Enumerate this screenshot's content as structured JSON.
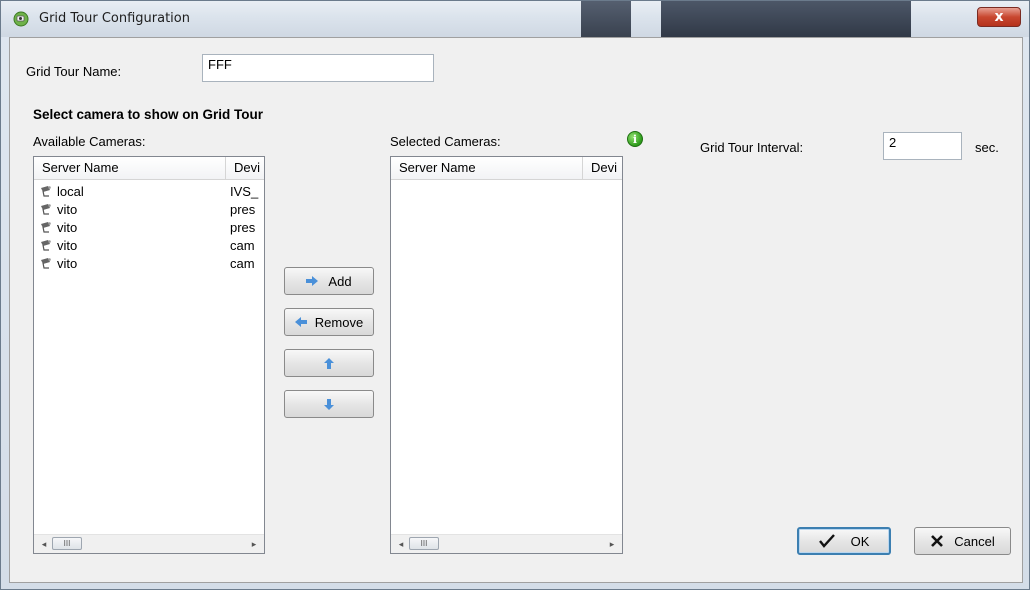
{
  "window": {
    "title": "Grid Tour Configuration",
    "close_glyph": "x"
  },
  "form": {
    "name_label": "Grid Tour Name:",
    "name_value": "FFF",
    "section_title": "Select camera to show on Grid Tour",
    "available_label": "Available Cameras:",
    "selected_label": "Selected Cameras:",
    "interval_label": "Grid Tour Interval:",
    "interval_value": "2",
    "interval_unit": "sec."
  },
  "available": {
    "columns": [
      "Server Name",
      "Devi"
    ],
    "rows": [
      {
        "server": "local",
        "device": "IVS_"
      },
      {
        "server": "vito",
        "device": "pres"
      },
      {
        "server": "vito",
        "device": "pres"
      },
      {
        "server": "vito",
        "device": "cam"
      },
      {
        "server": "vito",
        "device": "cam"
      }
    ]
  },
  "selected": {
    "columns": [
      "Server Name",
      "Devi"
    ],
    "rows": []
  },
  "buttons": {
    "add": "Add",
    "remove": "Remove",
    "ok": "OK",
    "cancel": "Cancel"
  },
  "scrollbar": {
    "left": "◂",
    "right": "▸",
    "thumb": "III"
  },
  "colors": {
    "arrow_icon": "#4a90d9",
    "info_icon": "#2e9b1c",
    "close_button": "#c8472f"
  }
}
